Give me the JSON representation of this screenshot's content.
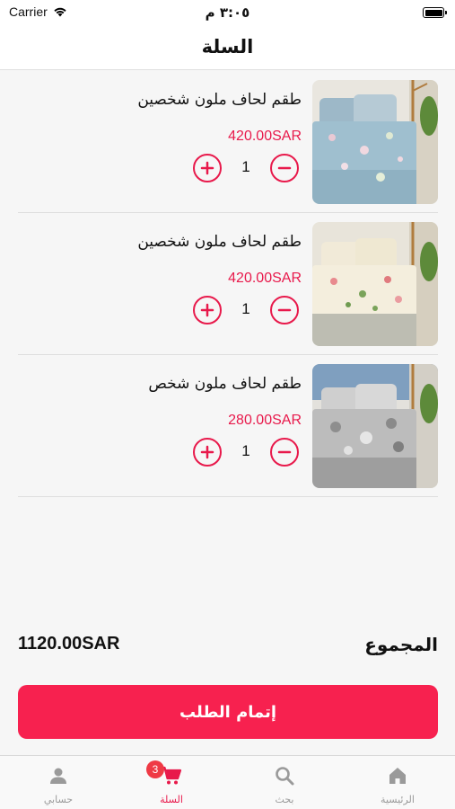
{
  "status_bar": {
    "carrier": "Carrier",
    "time": "٣:٠٥ م"
  },
  "header": {
    "title": "السلة"
  },
  "cart": {
    "items": [
      {
        "name": "طقم لحاف ملون شخصين",
        "price": "420.00SAR",
        "quantity": "1"
      },
      {
        "name": "طقم لحاف ملون شخصين",
        "price": "420.00SAR",
        "quantity": "1"
      },
      {
        "name": "طقم لحاف ملون شخص",
        "price": "280.00SAR",
        "quantity": "1"
      }
    ],
    "total_label": "المجموع",
    "total_amount": "1120.00SAR",
    "checkout_label": "إتمام الطلب"
  },
  "tabs": [
    {
      "label": "الرئيسية",
      "icon": "home-icon"
    },
    {
      "label": "بحث",
      "icon": "search-icon"
    },
    {
      "label": "السلة",
      "icon": "cart-icon",
      "badge": "3",
      "active": true
    },
    {
      "label": "حسابي",
      "icon": "person-icon"
    }
  ],
  "colors": {
    "accent": "#e8194b",
    "checkout_button": "#f7214f",
    "badge": "#ef3a45"
  }
}
